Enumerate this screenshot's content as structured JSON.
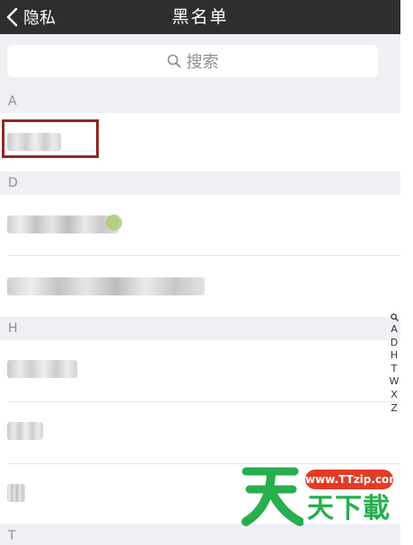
{
  "nav": {
    "back_label": "隐私",
    "title": "黑名单"
  },
  "search": {
    "placeholder": "搜索"
  },
  "sections": [
    {
      "letter": "A"
    },
    {
      "letter": "D"
    },
    {
      "letter": "H"
    },
    {
      "letter": "T"
    }
  ],
  "index_bar": [
    "A",
    "D",
    "H",
    "T",
    "W",
    "X",
    "Z"
  ],
  "watermark": {
    "url": "www.TTzip.com",
    "text": "天下載"
  },
  "colors": {
    "navbar": "#2e2e31",
    "background": "#f0eff4",
    "highlight": "#8b2a22",
    "watermark_green": "#27ae4d",
    "watermark_red": "#e33b26"
  }
}
